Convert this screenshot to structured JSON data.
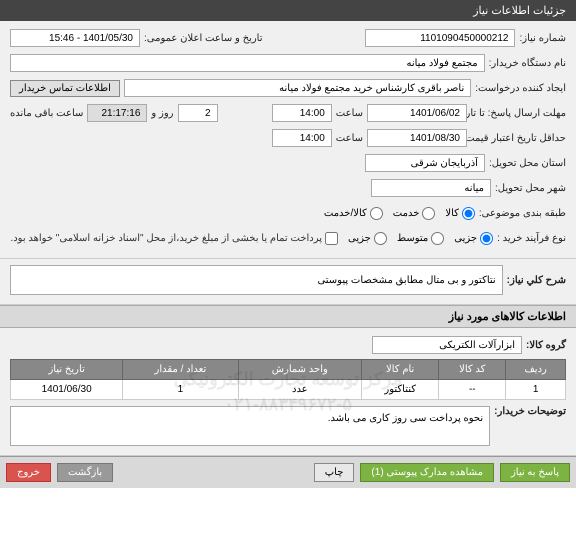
{
  "titlebar": "جزئیات اطلاعات نیاز",
  "fields": {
    "need_no_label": "شماره نیاز:",
    "need_no": "1101090450000212",
    "announce_label": "تاریخ و ساعت اعلان عمومی:",
    "announce_value": "1401/05/30 - 15:46",
    "buyer_label": "نام دستگاه خریدار:",
    "buyer_value": "مجتمع فولاد میانه",
    "creator_label": "ایجاد کننده درخواست:",
    "creator_value": "ناصر باقری کارشناس خرید مجتمع فولاد میانه",
    "contact_btn": "اطلاعات تماس خریدار",
    "deadline_label": "مهلت ارسال پاسخ: تا تاریخ:",
    "deadline_date": "1401/06/02",
    "time_label": "ساعت",
    "deadline_time": "14:00",
    "days_label": "روز و",
    "days_value": "2",
    "remaining_label": "ساعت باقی مانده",
    "remaining_value": "21:17:16",
    "validity_label": "حداقل تاریخ اعتبار قیمت: تا تاریخ:",
    "validity_date": "1401/08/30",
    "validity_time": "14:00",
    "province_label": "استان محل تحویل:",
    "province_value": "آذربایجان شرقی",
    "city_label": "شهر محل تحویل:",
    "city_value": "میانه",
    "category_label": "طبقه بندی موضوعی:",
    "cat_goods": "کالا",
    "cat_service": "خدمت",
    "cat_both": "کالا/خدمت",
    "purchase_type_label": "نوع فرآیند خرید :",
    "pt_small": "جزیی",
    "pt_medium": "متوسط",
    "pt_large": "جزیی",
    "purchase_note": "پرداخت تمام یا بخشی از مبلغ خرید،از محل \"اسناد خزانه اسلامی\" خواهد بود."
  },
  "desc": {
    "label": "شرح کلي نیاز:",
    "value": "نتاکتور و بی متال مطابق مشخصات پیوستی"
  },
  "goods_section": "اطلاعات کالاهای مورد نیاز",
  "group": {
    "label": "گروه کالا:",
    "value": "ابزارآلات الکتریکی"
  },
  "watermark_line1": "مرکز توسعه تجارت الکترونیکی",
  "watermark_line2": "۰۲۱-۸۸۳۴۹۶۷۲-۵",
  "table": {
    "headers": [
      "ردیف",
      "کد کالا",
      "نام کالا",
      "واحد شمارش",
      "تعداد / مقدار",
      "تاریخ نیاز"
    ],
    "row": [
      "1",
      "--",
      "کنتاکتور",
      "عدد",
      "1",
      "1401/06/30"
    ]
  },
  "buyer_notes": {
    "label": "توضیحات خریدار:",
    "value": "نحوه پرداخت سی روز کاری می باشد."
  },
  "buttons": {
    "respond": "پاسخ به نیاز",
    "attachments": "مشاهده مدارک پیوستی (1)",
    "print": "چاپ",
    "back": "بازگشت",
    "exit": "خروج"
  }
}
